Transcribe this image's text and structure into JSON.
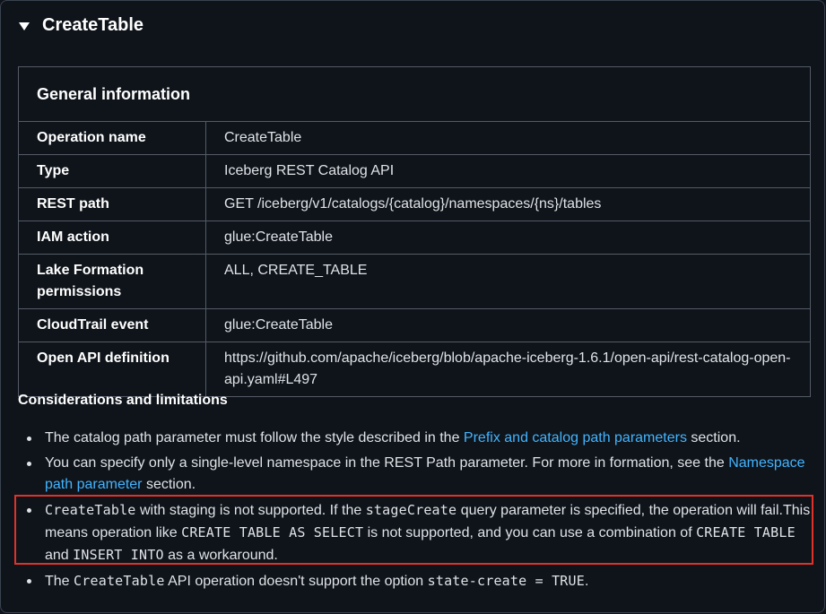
{
  "section": {
    "title": "CreateTable"
  },
  "general_info": {
    "caption": "General information",
    "rows": [
      {
        "key": "Operation name",
        "value": "CreateTable"
      },
      {
        "key": "Type",
        "value": "Iceberg REST Catalog API"
      },
      {
        "key": "REST path",
        "value": "GET /iceberg/v1/catalogs/{catalog}/namespaces/{ns}/tables"
      },
      {
        "key": "IAM action",
        "value": "glue:CreateTable"
      },
      {
        "key": "Lake Formation permissions",
        "value": "ALL, CREATE_TABLE"
      },
      {
        "key": "CloudTrail event",
        "value": "glue:CreateTable"
      },
      {
        "key": "Open API definition",
        "value": "https://github.com/apache/iceberg/blob/apache-iceberg-1.6.1/open-api/rest-catalog-open-api.yaml#L497"
      }
    ]
  },
  "considerations": {
    "title": "Considerations and limitations",
    "b1": {
      "pre": "The catalog path parameter must follow the style described in the ",
      "link": "Prefix and catalog path parameters",
      "post": " section."
    },
    "b2": {
      "pre": "You can specify only a single-level namespace in the REST Path parameter. For more in formation, see the ",
      "link": "Namespace path parameter",
      "post": " section."
    },
    "b3": {
      "code1": "CreateTable",
      "t1": " with staging is not supported. If the ",
      "code2": "stageCreate",
      "t2": " query parameter is specified, the operation will fail.This means operation like ",
      "code3": "CREATE TABLE AS SELECT",
      "t3": " is not supported, and you can use a combination of ",
      "code4": "CREATE TABLE",
      "t4": " and ",
      "code5": "INSERT INTO",
      "t5": " as a workaround."
    },
    "b4": {
      "t1": "The ",
      "code1": "CreateTable",
      "t2": " API operation doesn't support the option ",
      "code2": "state-create = TRUE",
      "t3": "."
    }
  },
  "colors": {
    "background": "#0f141a",
    "link": "#42b4ff",
    "highlight_border": "#e0312a"
  }
}
